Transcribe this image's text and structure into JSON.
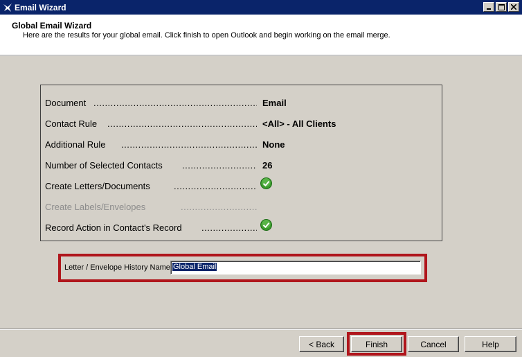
{
  "window": {
    "title": "Email Wizard",
    "icon": "wizard-icon"
  },
  "header": {
    "title": "Global Email Wizard",
    "subtitle": "Here are the results for your global email.  Click finish to open Outlook and begin working on the email merge."
  },
  "summary": {
    "rows": [
      {
        "label": "Document",
        "dots": "...............................................................",
        "value": "Email"
      },
      {
        "label": "Contact Rule",
        "dots": "...............................................................",
        "value": "<All> - All Clients"
      },
      {
        "label": "Additional Rule",
        "dots": "...............................................................",
        "value": "None"
      },
      {
        "label": "Number of Selected Contacts",
        "dots": "...............................................................",
        "value": "26"
      },
      {
        "label": "Create Letters/Documents",
        "dots": "...............................................................",
        "value": "",
        "check": true
      },
      {
        "label": "Create Labels/Envelopes",
        "dots": "...............................................................",
        "value": "",
        "disabled": true
      },
      {
        "label": "Record Action in Contact's Record",
        "dots": "...............................................................",
        "value": "",
        "check": true
      }
    ]
  },
  "history": {
    "label": "Letter / Envelope History Name",
    "value": "Global Email"
  },
  "buttons": {
    "back": "< Back",
    "finish": "Finish",
    "cancel": "Cancel",
    "help": "Help"
  },
  "colors": {
    "titlebar": "#0a246a",
    "highlight_frame": "#b0161c",
    "check_green": "#3a9a2c"
  }
}
